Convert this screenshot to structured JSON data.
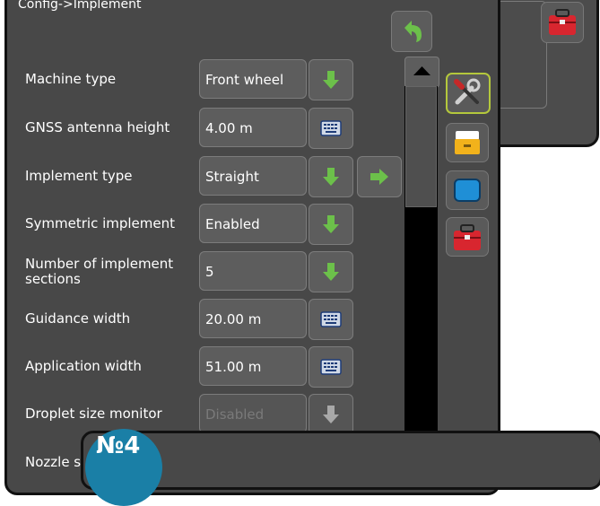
{
  "title": "Config->Implement",
  "badge_label": "№4",
  "fields": [
    {
      "label": "Machine type",
      "value": "Front wheel",
      "control": "dropdown"
    },
    {
      "label": "GNSS antenna height",
      "value": "4.00 m",
      "control": "keyboard"
    },
    {
      "label": "Implement type",
      "value": "Straight",
      "control": "dropdown",
      "has_next": true
    },
    {
      "label": "Symmetric implement",
      "value": "Enabled",
      "control": "dropdown"
    },
    {
      "label": "Number of implement sections",
      "value": "5",
      "control": "dropdown"
    },
    {
      "label": "Guidance width",
      "value": "20.00 m",
      "control": "keyboard"
    },
    {
      "label": "Application width",
      "value": "51.00 m",
      "control": "keyboard"
    },
    {
      "label": "Droplet size monitor",
      "value": "Disabled",
      "control": "dropdown",
      "disabled": true
    },
    {
      "label": "Nozzle s",
      "value": "",
      "control": "none",
      "has_next": true,
      "next_disabled": true
    }
  ],
  "side_tabs": [
    "tools-tab",
    "storage-tab",
    "display-tab",
    "toolbox-tab"
  ],
  "colors": {
    "panel": "#484848",
    "accent_green": "#6cc04a",
    "active_border": "#b4c83c",
    "badge": "#1a7fa6"
  }
}
